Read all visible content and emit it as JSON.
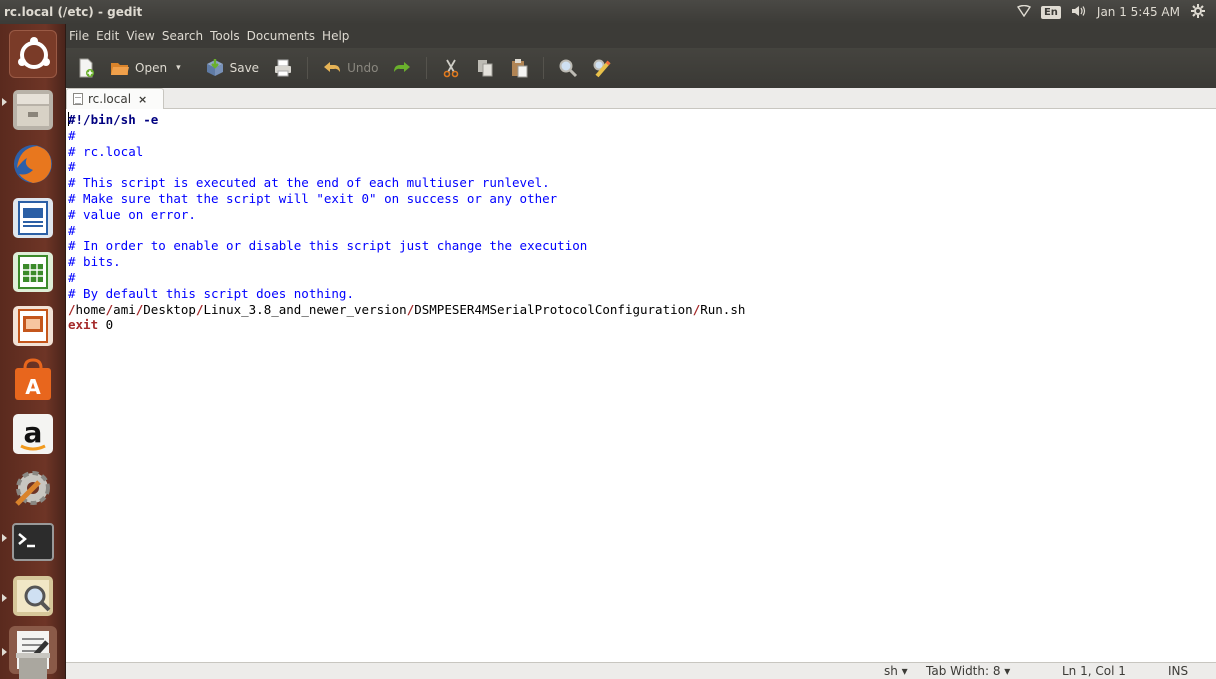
{
  "window": {
    "title": "rc.local (/etc) - gedit"
  },
  "indicators": {
    "network_icon": "network-icon",
    "keyboard_label": "En",
    "volume_icon": "volume-icon",
    "clock": "Jan 1  5:45 AM",
    "settings_icon": "gear-icon"
  },
  "menubar": {
    "items": [
      "File",
      "Edit",
      "View",
      "Search",
      "Tools",
      "Documents",
      "Help"
    ]
  },
  "toolbar": {
    "new_icon": "new-document-icon",
    "open_label": "Open",
    "save_label": "Save",
    "print_icon": "print-icon",
    "undo_label": "Undo",
    "redo_icon": "redo-icon",
    "cut_icon": "cut-icon",
    "copy_icon": "copy-icon",
    "paste_icon": "paste-icon",
    "find_icon": "search-icon",
    "replace_icon": "replace-icon"
  },
  "launcher": {
    "items": [
      "dash-home-icon",
      "files-icon",
      "firefox-icon",
      "writer-icon",
      "calc-icon",
      "impress-icon",
      "software-center-icon",
      "amazon-icon",
      "system-settings-icon",
      "terminal-icon",
      "image-viewer-icon",
      "text-editor-icon",
      "trash-icon"
    ]
  },
  "tab": {
    "label": "rc.local",
    "close": "×"
  },
  "editor": {
    "lines": [
      "#!/bin/sh -e",
      "#",
      "# rc.local",
      "#",
      "# This script is executed at the end of each multiuser runlevel.",
      "# Make sure that the script will \"exit 0\" on success or any other",
      "# value on error.",
      "#",
      "# In order to enable or disable this script just change the execution",
      "# bits.",
      "#",
      "# By default this script does nothing.",
      "/home/ami/Desktop/Linux_3.8_and_newer_version/DSMPESER4MSerialProtocolConfiguration/Run.sh",
      "exit 0"
    ]
  },
  "statusbar": {
    "language": "sh ▾",
    "tab_width": "Tab Width: 8 ▾",
    "position": "Ln 1, Col 1",
    "mode": "INS"
  }
}
